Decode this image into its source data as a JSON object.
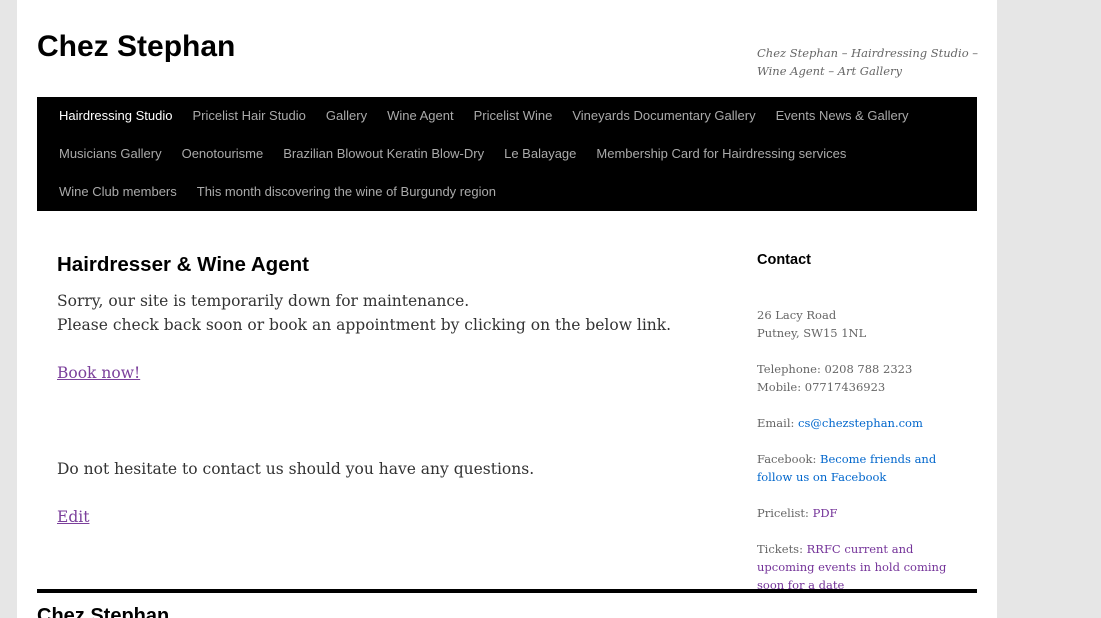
{
  "header": {
    "site_title": "Chez Stephan",
    "site_description": "Chez Stephan – Hairdressing Studio – Wine Agent – Art Gallery"
  },
  "nav": {
    "items": [
      {
        "label": "Hairdressing Studio"
      },
      {
        "label": "Pricelist Hair Studio"
      },
      {
        "label": "Gallery"
      },
      {
        "label": "Wine Agent"
      },
      {
        "label": "Pricelist Wine"
      },
      {
        "label": "Vineyards Documentary Gallery"
      },
      {
        "label": "Events News & Gallery"
      },
      {
        "label": "Musicians Gallery"
      },
      {
        "label": "Oenotourisme"
      },
      {
        "label": "Brazilian Blowout Keratin Blow-Dry"
      },
      {
        "label": "Le Balayage"
      },
      {
        "label": "Membership Card for Hairdressing services"
      },
      {
        "label": "Wine Club members"
      },
      {
        "label": "This month discovering the wine of Burgundy region"
      }
    ]
  },
  "content": {
    "title": "Hairdresser & Wine Agent",
    "line1": "Sorry, our site is temporarily down for maintenance.",
    "line2": "Please check back soon or book an appointment by clicking on the below link.",
    "book_link": "Book now!",
    "contact_note": "Do not hesitate to contact us should you have any questions.",
    "edit_link": "Edit"
  },
  "sidebar": {
    "title": "Contact",
    "address_line1": "26 Lacy Road",
    "address_line2": "Putney, SW15 1NL",
    "telephone": "Telephone: 0208 788 2323",
    "mobile": "Mobile: 07717436923",
    "email_label": "Email: ",
    "email_link": "cs@chezstephan.com",
    "facebook_label": "Facebook: ",
    "facebook_link": "Become friends and follow us on Facebook",
    "pricelist_label": "Pricelist: ",
    "pricelist_link": "PDF",
    "tickets_label": "Tickets: ",
    "tickets_link": "RRFC current and upcoming events in hold coming soon for a date"
  },
  "footer": {
    "title": "Chez Stephan"
  }
}
